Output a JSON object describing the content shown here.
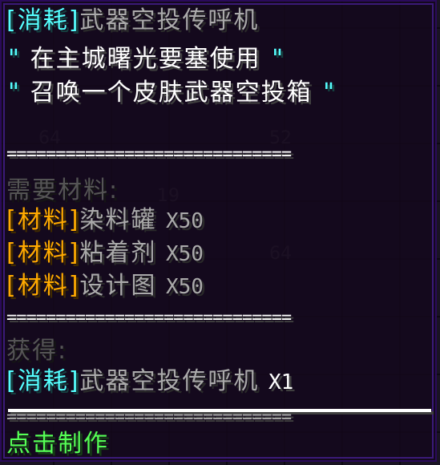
{
  "item": {
    "tag": "[消耗]",
    "name": "武器空投传呼机"
  },
  "lore": [
    {
      "open": "\"",
      "text": " 在主城曙光要塞使用 ",
      "close": "\""
    },
    {
      "open": "\"",
      "text": " 召唤一个皮肤武器空投箱 ",
      "close": "\""
    }
  ],
  "separator": "=============================",
  "materials": {
    "heading": "需要材料:",
    "items": [
      {
        "tag": "[材料]",
        "name": "染料罐",
        "qty": "X50"
      },
      {
        "tag": "[材料]",
        "name": "粘着剂",
        "qty": "X50"
      },
      {
        "tag": "[材料]",
        "name": "设计图",
        "qty": "X50"
      }
    ]
  },
  "reward": {
    "heading": "获得:",
    "tag": "[消耗]",
    "name": "武器空投传呼机",
    "qty": "X1"
  },
  "action": {
    "label": "点击制作"
  },
  "background_slots": {
    "counts": [
      "64",
      "52",
      "19",
      "64"
    ]
  },
  "colors": {
    "consumable": "#55ffff",
    "material": "#ffaa00",
    "action": "#55ff55",
    "heading": "#555555",
    "lore": "#ffffff",
    "name": "#aaaaaa"
  }
}
